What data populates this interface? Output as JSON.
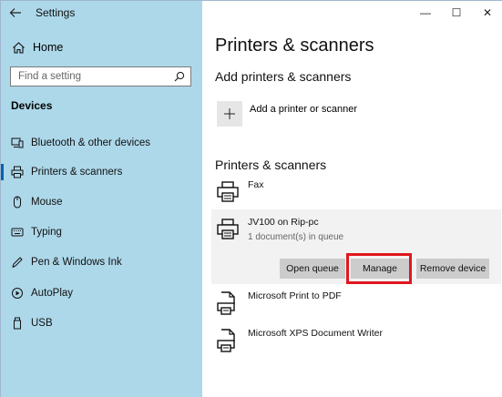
{
  "window": {
    "title": "Settings",
    "controls": {
      "minimize": "—",
      "maximize": "☐",
      "close": "✕"
    }
  },
  "sidebar": {
    "home_label": "Home",
    "search_placeholder": "Find a setting",
    "section_title": "Devices",
    "items": [
      {
        "label": "Bluetooth & other devices",
        "icon": "bluetooth-devices-icon",
        "active": false
      },
      {
        "label": "Printers & scanners",
        "icon": "printer-icon",
        "active": true
      },
      {
        "label": "Mouse",
        "icon": "mouse-icon",
        "active": false
      },
      {
        "label": "Typing",
        "icon": "keyboard-icon",
        "active": false
      },
      {
        "label": "Pen & Windows Ink",
        "icon": "pen-icon",
        "active": false
      },
      {
        "label": "AutoPlay",
        "icon": "autoplay-icon",
        "active": false
      },
      {
        "label": "USB",
        "icon": "usb-icon",
        "active": false
      }
    ]
  },
  "main": {
    "page_title": "Printers & scanners",
    "add_heading": "Add printers & scanners",
    "add_label": "Add a printer or scanner",
    "list_heading": "Printers & scanners",
    "printers": [
      {
        "name": "Fax",
        "status": ""
      },
      {
        "name": "JV100 on Rip-pc",
        "status": "1 document(s) in queue"
      },
      {
        "name": "Microsoft Print to PDF",
        "status": ""
      },
      {
        "name": "Microsoft XPS Document Writer",
        "status": ""
      }
    ],
    "buttons": {
      "open_queue": "Open queue",
      "manage": "Manage",
      "remove": "Remove device"
    }
  },
  "colors": {
    "sidebar_bg": "#add8ea",
    "accent": "#0063b1",
    "highlight": "#e0171e",
    "button_bg": "#cccccc"
  }
}
